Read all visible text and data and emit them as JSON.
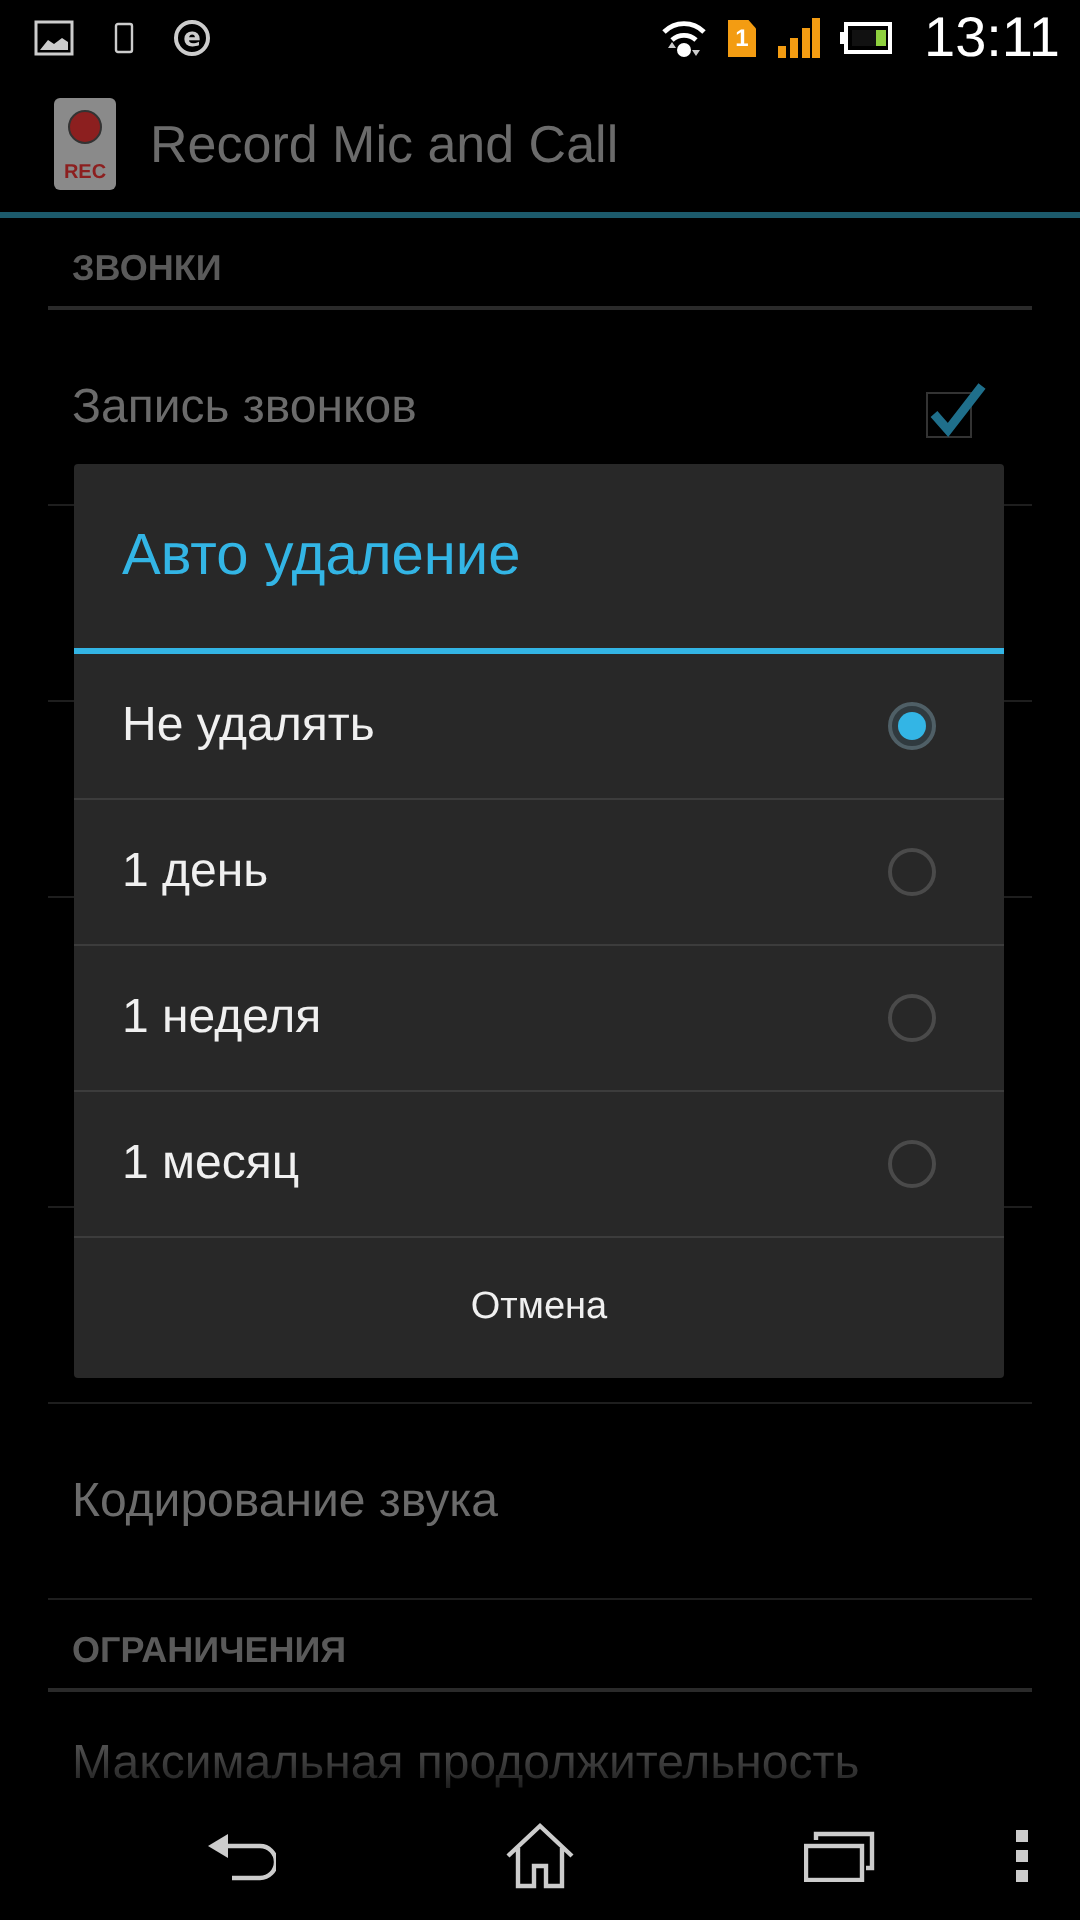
{
  "status_bar": {
    "network_badge": "e",
    "sim_badge": "1",
    "time": "13:11"
  },
  "app_bar": {
    "icon_label": "REC",
    "title": "Record Mic and Call"
  },
  "preferences": [
    {
      "kind": "category",
      "title": "ЗВОНКИ"
    },
    {
      "kind": "checkbox",
      "title": "Запись звонков",
      "checked": true
    },
    {
      "kind": "covered"
    },
    {
      "kind": "plain",
      "title": "Кодирование звука"
    },
    {
      "kind": "category",
      "title": "ОГРАНИЧЕНИЯ"
    },
    {
      "kind": "fading",
      "title": "Максимальная продолжительность"
    }
  ],
  "dialog": {
    "title": "Авто удаление",
    "options": [
      {
        "label": "Не удалять",
        "selected": true
      },
      {
        "label": "1 день",
        "selected": false
      },
      {
        "label": "1 неделя",
        "selected": false
      },
      {
        "label": "1 месяц",
        "selected": false
      }
    ],
    "button": "Отмена"
  }
}
